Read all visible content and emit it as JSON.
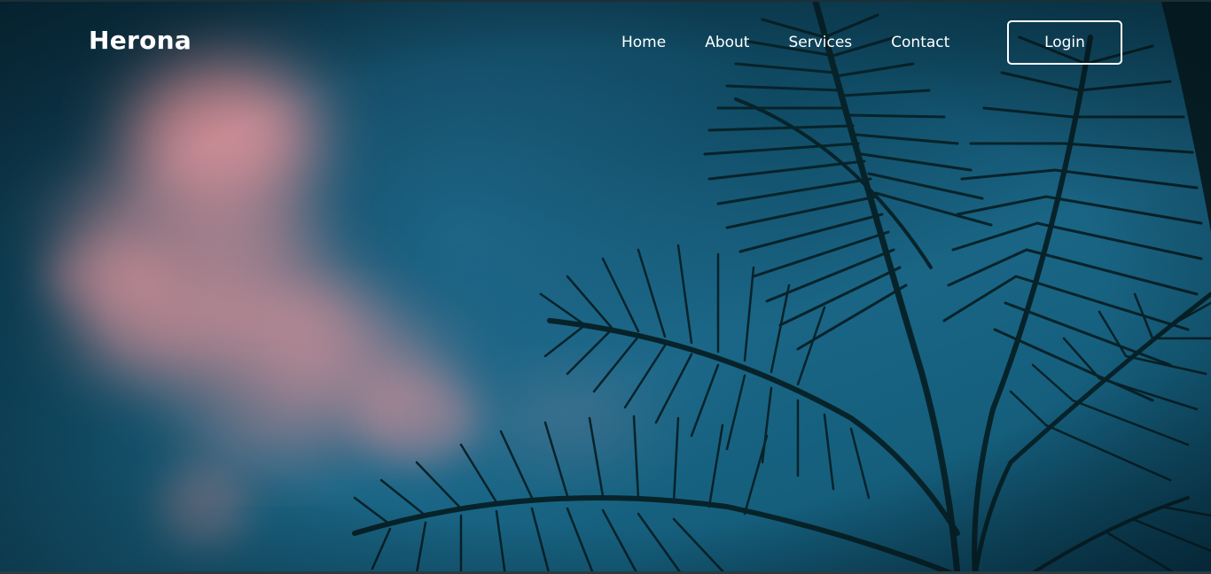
{
  "header": {
    "brand": "Herona",
    "nav": [
      {
        "label": "Home"
      },
      {
        "label": "About"
      },
      {
        "label": "Services"
      },
      {
        "label": "Contact"
      }
    ],
    "login_label": "Login"
  },
  "hero": {
    "background": {
      "sky_color": "#125a78",
      "cloud_color": "#e79aa0",
      "palm_color": "#07232a"
    }
  }
}
